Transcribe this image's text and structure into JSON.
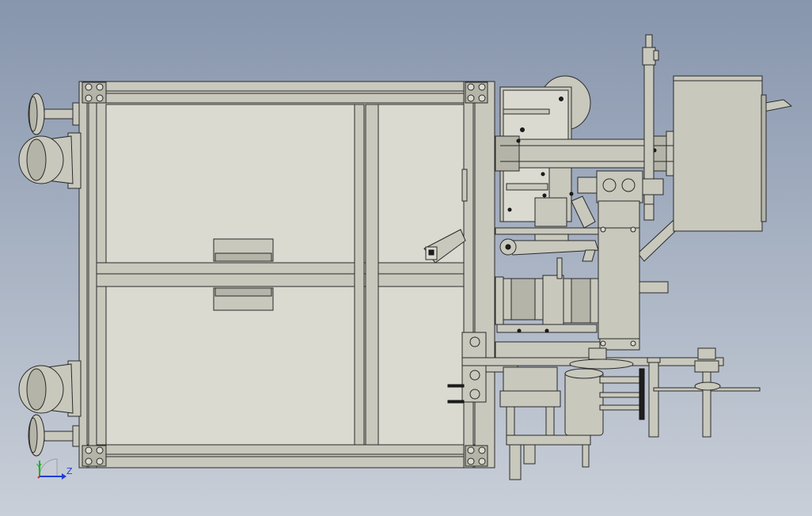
{
  "viewport": {
    "background_top": "#8795ad",
    "background_bottom": "#c9cfd8",
    "part_color": "#c8c8bd",
    "edge_color": "#2a2a2a"
  },
  "triad": {
    "y_label": "Y",
    "z_label": "Z",
    "y_color": "#21b021",
    "z_color": "#1f3fd6",
    "x_color": "#d42020"
  }
}
